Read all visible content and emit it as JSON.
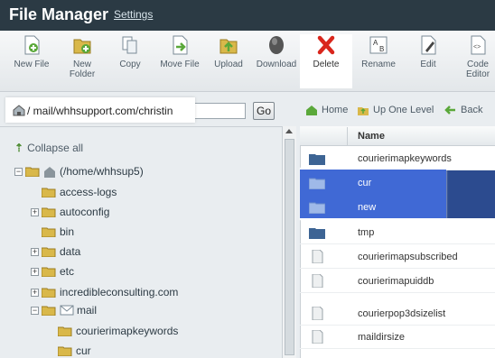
{
  "header": {
    "title": "File Manager",
    "settings": "Settings"
  },
  "toolbar": {
    "buttons": [
      {
        "label": "New File",
        "icon": "new-file-icon"
      },
      {
        "label": "New\nFolder",
        "icon": "new-folder-icon"
      },
      {
        "label": "Copy",
        "icon": "copy-icon"
      },
      {
        "label": "Move File",
        "icon": "move-file-icon"
      },
      {
        "label": "Upload",
        "icon": "upload-icon"
      },
      {
        "label": "Download",
        "icon": "download-icon"
      },
      {
        "label": "Delete",
        "icon": "delete-icon",
        "active": true
      },
      {
        "label": "Rename",
        "icon": "rename-icon"
      },
      {
        "label": "Edit",
        "icon": "edit-icon"
      },
      {
        "label": "Code\nEditor",
        "icon": "code-editor-icon"
      }
    ]
  },
  "address": {
    "value": "mail/whhsupport.com/christin",
    "go": "Go"
  },
  "nav": {
    "home": "Home",
    "up": "Up One Level",
    "back": "Back"
  },
  "tree": {
    "collapse_all": "Collapse all",
    "root": "(/home/whhsup5)",
    "items": [
      {
        "label": "access-logs",
        "expandable": false
      },
      {
        "label": "autoconfig",
        "expandable": true
      },
      {
        "label": "bin",
        "expandable": false
      },
      {
        "label": "data",
        "expandable": true
      },
      {
        "label": "etc",
        "expandable": true
      },
      {
        "label": "incredibleconsulting.com",
        "expandable": true
      },
      {
        "label": "mail",
        "expandable": true,
        "expanded": true
      }
    ],
    "mail_children": [
      {
        "label": "courierimapkeywords"
      },
      {
        "label": "cur"
      }
    ]
  },
  "files": {
    "header_name": "Name",
    "rows": [
      {
        "name": "courierimapkeywords",
        "type": "folder",
        "selected": false
      },
      {
        "name": "cur",
        "type": "folder",
        "selected": true
      },
      {
        "name": "new",
        "type": "folder",
        "selected": true
      },
      {
        "name": "tmp",
        "type": "folder",
        "selected": false
      },
      {
        "name": "courierimapsubscribed",
        "type": "file",
        "selected": false
      },
      {
        "name": "courierimapuiddb",
        "type": "file",
        "selected": false
      },
      {
        "name": "courierpop3dsizelist",
        "type": "file",
        "selected": false
      },
      {
        "name": "maildirsize",
        "type": "file",
        "selected": false
      }
    ]
  },
  "colors": {
    "header_bg": "#2b3a44",
    "selection": "#3c6fd1",
    "delete_red": "#d9261c"
  }
}
